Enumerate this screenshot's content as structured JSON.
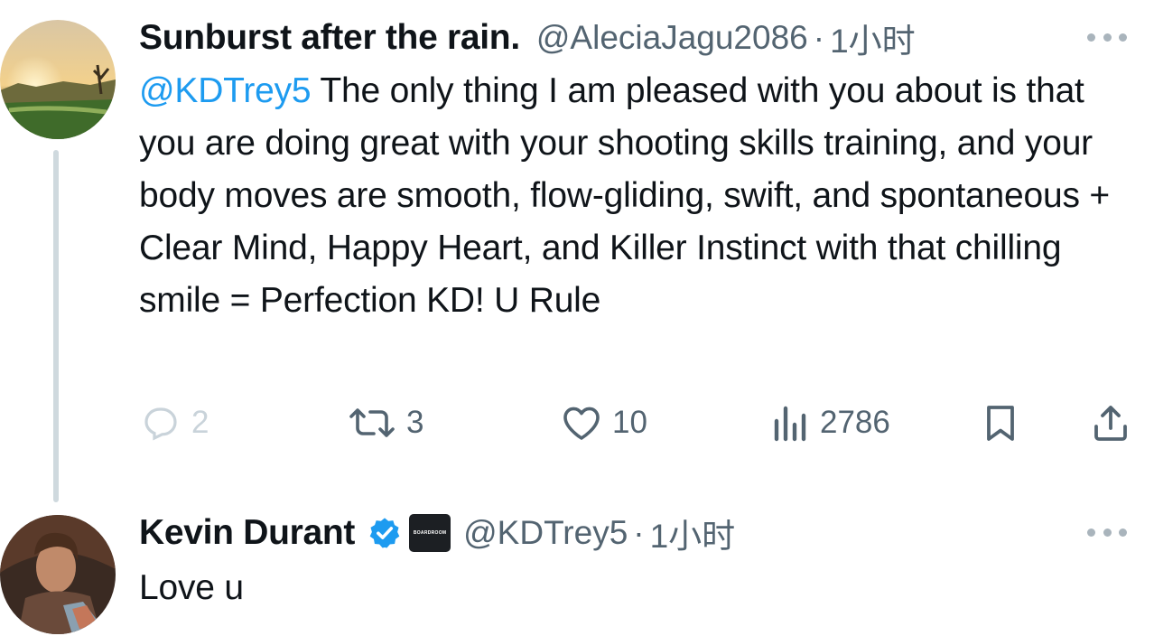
{
  "tweet1": {
    "display_name": "Sunburst after the rain.",
    "handle": "@AleciaJagu2086",
    "separator": "·",
    "time": "1小时",
    "mention": "@KDTrey5",
    "text": " The only thing I am pleased with you about is that you are doing great with your shooting skills training, and your body moves are smooth, flow-gliding, swift, and spontaneous + Clear Mind, Happy Heart, and Killer Instinct with that chilling smile = Perfection KD! U Rule",
    "actions": {
      "replies": "2",
      "retweets": "3",
      "likes": "10",
      "views": "2786"
    }
  },
  "tweet2": {
    "display_name": "Kevin Durant",
    "affiliate_label": "BOARDROOM",
    "handle": "@KDTrey5",
    "separator": "·",
    "time": "1小时",
    "text": "Love u"
  },
  "colors": {
    "accent": "#1d9bf0",
    "secondary_text": "#536471",
    "primary_text": "#0f1419",
    "thread_line": "#cfd9de"
  },
  "icons": [
    "reply-icon",
    "retweet-icon",
    "like-icon",
    "views-icon",
    "bookmark-icon",
    "share-icon",
    "verified-badge-icon",
    "more-icon"
  ]
}
